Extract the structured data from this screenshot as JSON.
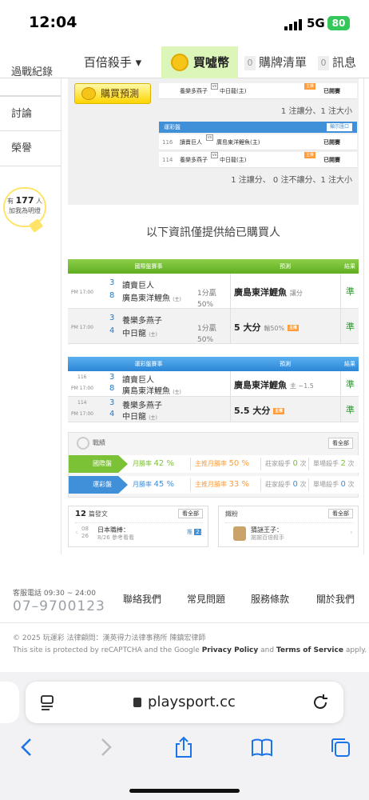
{
  "status": {
    "time": "12:04",
    "network": "5G",
    "battery": "80"
  },
  "topnav": {
    "brand": "百倍殺手 ▾",
    "buy": "買噓幣",
    "tab_list": {
      "count": "0",
      "label": "購牌清單"
    },
    "tab_msg": {
      "count": "0",
      "label": "訊息"
    }
  },
  "sidebar": {
    "items": [
      "過戰紀錄",
      "討論",
      "榮譽"
    ],
    "bulb_pre": "有",
    "bulb_count": "177",
    "bulb_unit": "人",
    "bulb_post": "加我為明燈"
  },
  "pred_top": {
    "buy_btn": "購買預測",
    "row0": {
      "home": "養樂多燕子",
      "away": "中日龍(主)",
      "status": "已開賽"
    },
    "sum1": "1 注讓分、1 注大小",
    "lottery_head": "運彩盤",
    "lottery_btn": "顯示匯口",
    "rows": [
      {
        "no": "116",
        "home": "讀賣巨人",
        "away": "廣島東洋鯉魚(主)",
        "status": "已開賽"
      },
      {
        "no": "114",
        "home": "養樂多燕子",
        "away": "中日龍(主)",
        "status": "已開賽"
      }
    ],
    "sum2": "1 注讓分、 0 注不讓分、1 注大小"
  },
  "info_line": "以下資訊僅提供給已購買人",
  "intl_table": {
    "head": {
      "games": "國際盤賽事",
      "pred": "預測",
      "result": "結果"
    },
    "rows": [
      {
        "time": "PM 17:00",
        "n1": "3",
        "t1": "讀賣巨人",
        "n2": "8",
        "t2": "廣島東洋鯉魚",
        "host": "(主)",
        "odds1": "1分贏",
        "odds2": "50%",
        "pick": "廣島東洋鯉魚",
        "pick_note": "讓分",
        "result": "準"
      },
      {
        "time": "PM 17:00",
        "n1": "3",
        "t1": "養樂多燕子",
        "n2": "4",
        "t2": "中日龍",
        "host": "(主)",
        "odds1": "1分贏",
        "odds2": "50%",
        "pick": "5 大分",
        "pick_note": "輸50%",
        "result": "準"
      }
    ]
  },
  "lottery_table": {
    "head": {
      "games": "運彩盤賽事",
      "pred": "預測",
      "result": "結果"
    },
    "rows": [
      {
        "no": "116",
        "time": "PM 17:00",
        "n1": "3",
        "t1": "讀賣巨人",
        "n2": "8",
        "t2": "廣島東洋鯉魚",
        "host": "(主)",
        "pick": "廣島東洋鯉魚",
        "pick_note": "主 −1.5",
        "result": "準"
      },
      {
        "no": "114",
        "time": "PM 17:00",
        "n1": "3",
        "t1": "養樂多燕子",
        "n2": "4",
        "t2": "中日龍",
        "host": "(主)",
        "pick": "5.5 大分",
        "pick_note": "",
        "result": "準"
      }
    ]
  },
  "stats": {
    "title": "戰績",
    "view_all": "看全部",
    "rows": [
      {
        "label": "國際盤",
        "month_label": "月勝率",
        "month": "42 %",
        "main_label": "主推月勝率",
        "main": "50 %",
        "house_label": "莊家殺手",
        "house": "0",
        "house_unit": "次",
        "cold_label": "單場殺手",
        "cold": "2",
        "cold_unit": "次"
      },
      {
        "label": "運彩盤",
        "month_label": "月勝率",
        "month": "45 %",
        "main_label": "主推月勝率",
        "main": "33 %",
        "house_label": "莊家殺手",
        "house": "0",
        "house_unit": "次",
        "cold_label": "單場殺手",
        "cold": "0",
        "cold_unit": "次"
      }
    ]
  },
  "widgets": {
    "posts": {
      "count": "12",
      "title": "篇發文",
      "view_all": "看全部",
      "date1": "08",
      "date2": "26",
      "item_title": "日本職棒：",
      "item_sub": "8/26 參考看看",
      "badge_pre": "推",
      "badge": "2"
    },
    "fans": {
      "title": "鐵粉",
      "view_all": "看全部",
      "name": "猜謎王子：",
      "sub": "謝謝百倍殺手"
    }
  },
  "footer": {
    "service": "客服電話 09:30 ~ 24:00",
    "phone": "07–9700123",
    "links": [
      "聯絡我們",
      "常見問題",
      "服務條款",
      "關於我們"
    ],
    "copyright": "© 2025 玩運彩 法律顧問：漢英得力法律事務所 陳鎮宏律師",
    "captcha_pre": "This site is protected by reCAPTCHA and the Google",
    "privacy": "Privacy Policy",
    "and": "and",
    "terms": "Terms of Service",
    "apply": "apply."
  },
  "safari": {
    "url": "playsport.cc"
  }
}
